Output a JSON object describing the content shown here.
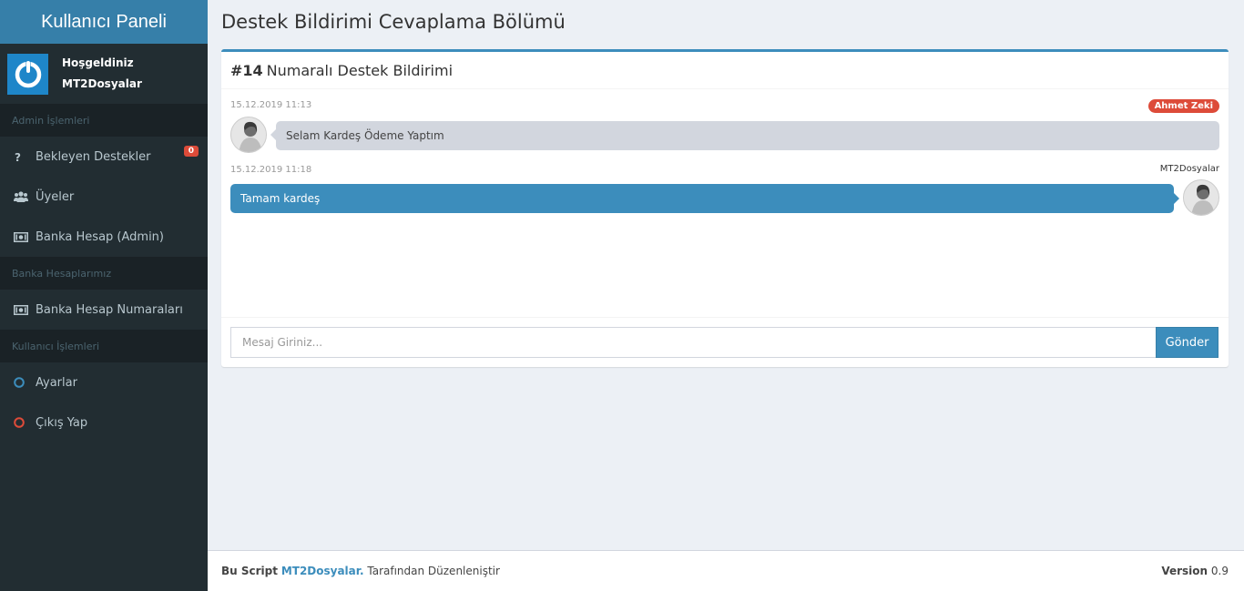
{
  "sidebar": {
    "brand": "Kullanıcı Paneli",
    "user": {
      "greeting": "Hoşgeldiniz",
      "name": "MT2Dosyalar"
    },
    "sections": [
      {
        "header": "Admin İşlemleri"
      },
      {
        "header": "Banka Hesaplarımız"
      },
      {
        "header": "Kullanıcı İşlemleri"
      }
    ],
    "items": [
      {
        "label": "Bekleyen Destekler",
        "icon": "question-icon",
        "badge": "0"
      },
      {
        "label": "Üyeler",
        "icon": "users-icon"
      },
      {
        "label": "Banka Hesap (Admin)",
        "icon": "money-icon"
      },
      {
        "label": "Banka Hesap Numaraları",
        "icon": "money-icon"
      },
      {
        "label": "Ayarlar",
        "icon": "circle-blue-icon"
      },
      {
        "label": "Çıkış Yap",
        "icon": "circle-red-icon"
      }
    ]
  },
  "page": {
    "title": "Destek Bildirimi Cevaplama Bölümü"
  },
  "ticket": {
    "number": "#14",
    "title": "Numaralı Destek Bildirimi",
    "messages": [
      {
        "date": "15.12.2019 11:13",
        "author": "Ahmet Zeki",
        "text": "Selam Kardeş Ödeme Yaptım"
      },
      {
        "date": "15.12.2019 11:18",
        "author": "MT2Dosyalar",
        "text": "Tamam kardeş"
      }
    ],
    "input_placeholder": "Mesaj Giriniz...",
    "send_label": "Gönder"
  },
  "footer": {
    "prefix": "Bu Script",
    "brand": "MT2Dosyalar.",
    "suffix": "Tarafından Düzenleniştir",
    "version_label": "Version",
    "version": "0.9"
  },
  "colors": {
    "primary": "#3c8dbc",
    "sidebar": "#222d32",
    "danger": "#dd4b39"
  }
}
